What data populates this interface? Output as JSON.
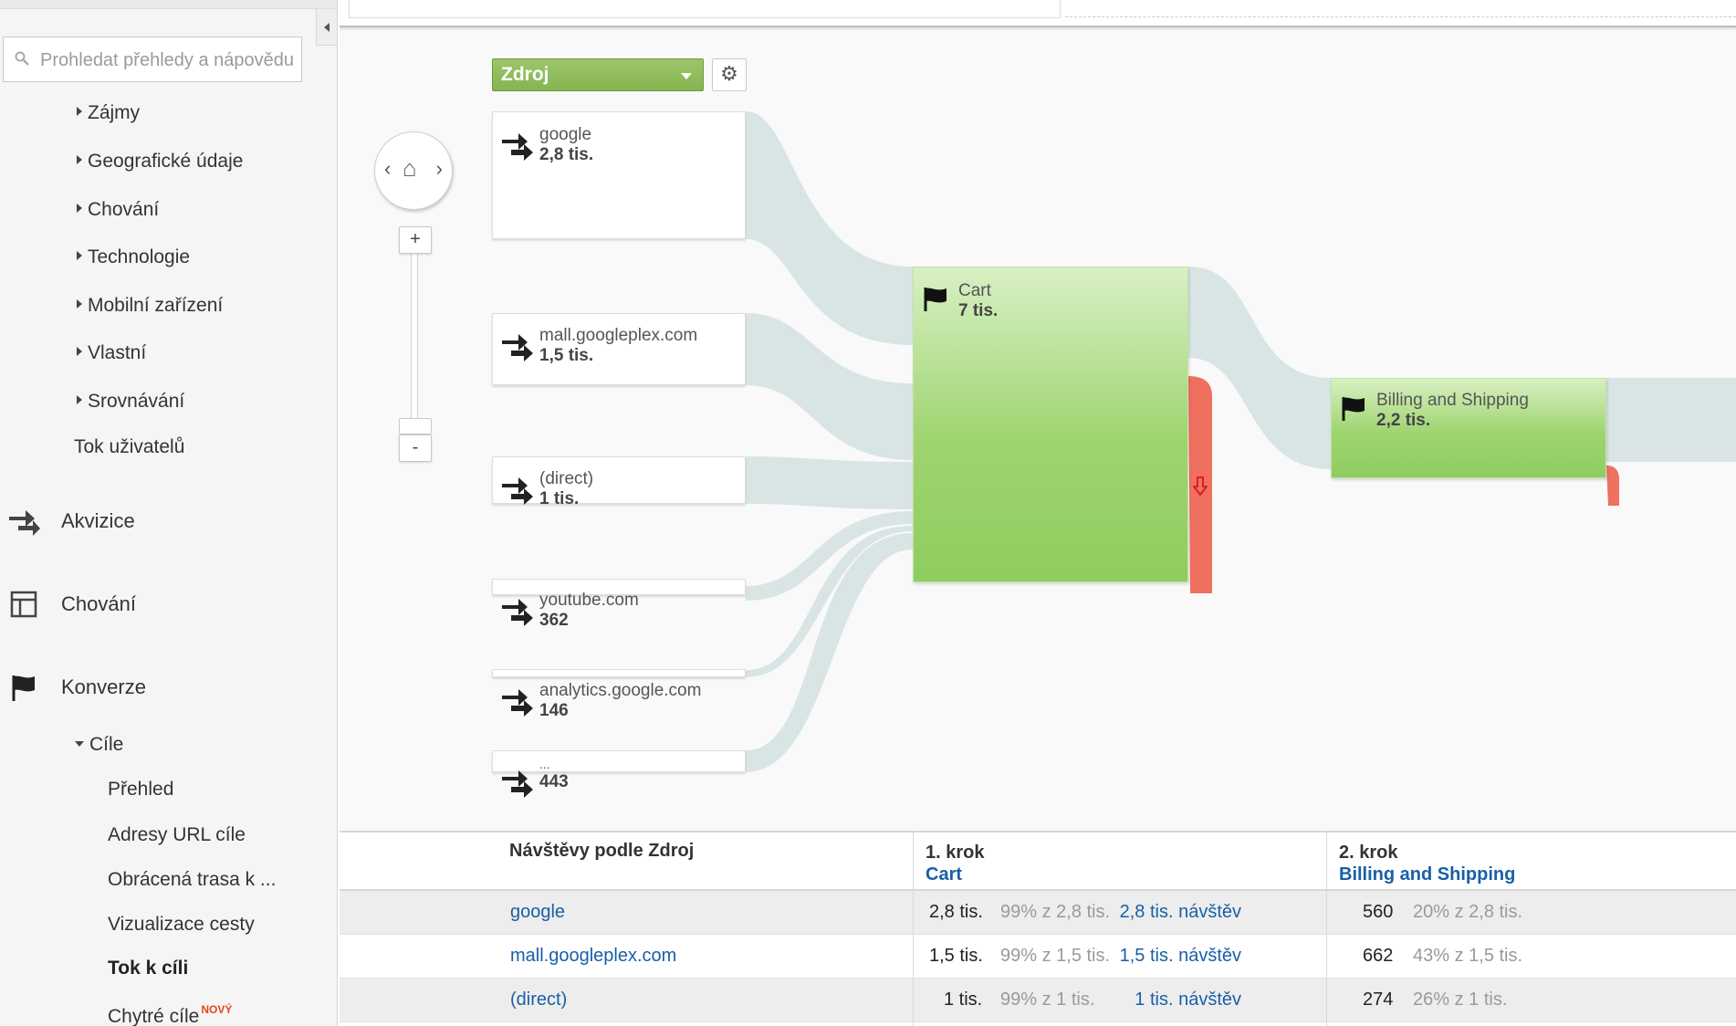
{
  "sidebar": {
    "search_placeholder": "Prohledat přehledy a nápovědu",
    "audience_items": [
      "Zájmy",
      "Geografické údaje",
      "Chování",
      "Technologie",
      "Mobilní zařízení",
      "Vlastní",
      "Srovnávání"
    ],
    "user_flow": "Tok uživatelů",
    "sections": [
      {
        "label": "Akvizice",
        "icon": "acquisition-arrows-icon"
      },
      {
        "label": "Chování",
        "icon": "behavior-layout-icon"
      },
      {
        "label": "Konverze",
        "icon": "conversion-flag-icon"
      }
    ],
    "goals_label": "Cíle",
    "goal_items": [
      "Přehled",
      "Adresy URL cíle",
      "Obrácená trasa k ...",
      "Vizualizace cesty",
      "Tok k cíli",
      "Chytré cíle"
    ],
    "active_item": "Tok k cíli",
    "new_badge": "NOVÝ"
  },
  "flow": {
    "dimension": "Zdroj",
    "sources": [
      {
        "name": "google",
        "value": "2,8 tis."
      },
      {
        "name": "mall.googleplex.com",
        "value": "1,5 tis."
      },
      {
        "name": "(direct)",
        "value": "1 tis."
      },
      {
        "name": "youtube.com",
        "value": "362"
      },
      {
        "name": "analytics.google.com",
        "value": "146"
      },
      {
        "name": "...",
        "value": "443"
      }
    ],
    "steps": [
      {
        "name": "Cart",
        "value": "7 tis."
      },
      {
        "name": "Billing and Shipping",
        "value": "2,2 tis."
      }
    ],
    "colors": {
      "goal": "#9fd46f",
      "dropoff": "#f07060",
      "link": "#d6e3e3",
      "select": "#8fbd5b"
    }
  },
  "table": {
    "col1_header": "Návštěvy podle Zdroj",
    "step1_header": "1. krok",
    "step1_link": "Cart",
    "step2_header": "2. krok",
    "step2_link": "Billing and Shipping",
    "rows": [
      {
        "source": "google",
        "visits": "2,8 tis. návštěv",
        "s1_value": "2,8 tis.",
        "s1_pct": "99% z 2,8 tis.",
        "s2_value": "560",
        "s2_pct": "20% z 2,8 tis."
      },
      {
        "source": "mall.googleplex.com",
        "visits": "1,5 tis. návštěv",
        "s1_value": "1,5 tis.",
        "s1_pct": "99% z 1,5 tis.",
        "s2_value": "662",
        "s2_pct": "43% z 1,5 tis."
      },
      {
        "source": "(direct)",
        "visits": "1 tis. návštěv",
        "s1_value": "1 tis.",
        "s1_pct": "99% z 1 tis.",
        "s2_value": "274",
        "s2_pct": "26% z 1 tis."
      }
    ]
  }
}
